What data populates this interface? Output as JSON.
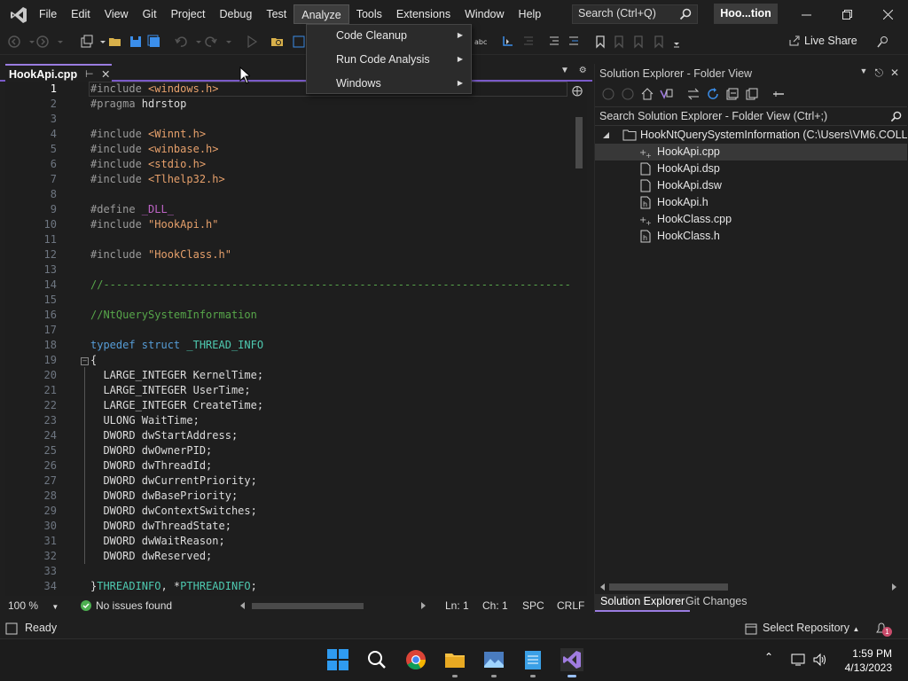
{
  "menubar": {
    "items": [
      "File",
      "Edit",
      "View",
      "Git",
      "Project",
      "Debug",
      "Test",
      "Analyze",
      "Tools",
      "Extensions",
      "Window",
      "Help"
    ],
    "active": "Analyze"
  },
  "search": {
    "placeholder": "Search (Ctrl+Q)"
  },
  "solution_name": "Hoo...tion",
  "toolbar": {
    "live_share_label": "Live Share"
  },
  "analyze_menu": {
    "items": [
      "Code Cleanup",
      "Run Code Analysis",
      "Windows"
    ]
  },
  "editor": {
    "tab_label": "HookApi.cpp",
    "current_line": 1,
    "line_numbers": [
      "1",
      "2",
      "3",
      "4",
      "5",
      "6",
      "7",
      "8",
      "9",
      "10",
      "11",
      "12",
      "13",
      "14",
      "15",
      "16",
      "17",
      "18",
      "19",
      "20",
      "21",
      "22",
      "23",
      "24",
      "25",
      "26",
      "27",
      "28",
      "29",
      "30",
      "31",
      "32",
      "33",
      "34"
    ],
    "lines": [
      {
        "t": [
          [
            "pp",
            "#include "
          ],
          [
            "inc",
            "<windows.h>"
          ]
        ]
      },
      {
        "t": [
          [
            "pp",
            "#pragma "
          ],
          [
            "txt",
            "hdrstop"
          ]
        ]
      },
      {
        "t": []
      },
      {
        "t": [
          [
            "pp",
            "#include "
          ],
          [
            "inc",
            "<Winnt.h>"
          ]
        ]
      },
      {
        "t": [
          [
            "pp",
            "#include "
          ],
          [
            "inc",
            "<winbase.h>"
          ]
        ]
      },
      {
        "t": [
          [
            "pp",
            "#include "
          ],
          [
            "inc",
            "<stdio.h>"
          ]
        ]
      },
      {
        "t": [
          [
            "pp",
            "#include "
          ],
          [
            "inc",
            "<Tlhelp32.h>"
          ]
        ]
      },
      {
        "t": []
      },
      {
        "t": [
          [
            "pp",
            "#define "
          ],
          [
            "macro",
            "_DLL_"
          ]
        ]
      },
      {
        "t": [
          [
            "pp",
            "#include "
          ],
          [
            "str",
            "\"HookApi.h\""
          ]
        ]
      },
      {
        "t": []
      },
      {
        "t": [
          [
            "pp",
            "#include "
          ],
          [
            "str",
            "\"HookClass.h\""
          ]
        ]
      },
      {
        "t": []
      },
      {
        "t": [
          [
            "cmt",
            "//-------------------------------------------------------------------------------------"
          ]
        ]
      },
      {
        "t": []
      },
      {
        "t": [
          [
            "cmt",
            "//NtQuerySystemInformation"
          ]
        ]
      },
      {
        "t": []
      },
      {
        "t": [
          [
            "type",
            "typedef "
          ],
          [
            "type",
            "struct "
          ],
          [
            "cls",
            "_THREAD_INFO"
          ]
        ]
      },
      {
        "t": [
          [
            "txt",
            "{"
          ]
        ]
      },
      {
        "t": [
          [
            "txt",
            "  LARGE_INTEGER KernelTime;"
          ]
        ]
      },
      {
        "t": [
          [
            "txt",
            "  LARGE_INTEGER UserTime;"
          ]
        ]
      },
      {
        "t": [
          [
            "txt",
            "  LARGE_INTEGER CreateTime;"
          ]
        ]
      },
      {
        "t": [
          [
            "txt",
            "  ULONG WaitTime;"
          ]
        ]
      },
      {
        "t": [
          [
            "txt",
            "  DWORD dwStartAddress;"
          ]
        ]
      },
      {
        "t": [
          [
            "txt",
            "  DWORD dwOwnerPID;"
          ]
        ]
      },
      {
        "t": [
          [
            "txt",
            "  DWORD dwThreadId;"
          ]
        ]
      },
      {
        "t": [
          [
            "txt",
            "  DWORD dwCurrentPriority;"
          ]
        ]
      },
      {
        "t": [
          [
            "txt",
            "  DWORD dwBasePriority;"
          ]
        ]
      },
      {
        "t": [
          [
            "txt",
            "  DWORD dwContextSwitches;"
          ]
        ]
      },
      {
        "t": [
          [
            "txt",
            "  DWORD dwThreadState;"
          ]
        ]
      },
      {
        "t": [
          [
            "txt",
            "  DWORD dwWaitReason;"
          ]
        ]
      },
      {
        "t": [
          [
            "txt",
            "  DWORD dwReserved;"
          ]
        ]
      },
      {
        "t": []
      },
      {
        "t": [
          [
            "txt",
            "}"
          ],
          [
            "cls",
            "THREADINFO"
          ],
          [
            "txt",
            ", *"
          ],
          [
            "cls",
            "PTHREADINFO"
          ],
          [
            "txt",
            ";"
          ]
        ]
      }
    ]
  },
  "editor_status": {
    "zoom": "100 %",
    "issues": "No issues found",
    "line": "Ln: 1",
    "char": "Ch: 1",
    "spacing": "SPC",
    "line_ending": "CRLF"
  },
  "solution_explorer": {
    "title": "Solution Explorer - Folder View",
    "search_placeholder": "Search Solution Explorer - Folder View (Ctrl+;)",
    "root": "HookNtQuerySystemInformation (C:\\Users\\VM6.COLLA",
    "files": [
      {
        "name": "HookApi.cpp",
        "icon": "cpp-file-icon",
        "selected": true
      },
      {
        "name": "HookApi.dsp",
        "icon": "file-icon",
        "selected": false
      },
      {
        "name": "HookApi.dsw",
        "icon": "file-icon",
        "selected": false
      },
      {
        "name": "HookApi.h",
        "icon": "header-file-icon",
        "selected": false
      },
      {
        "name": "HookClass.cpp",
        "icon": "cpp-file-icon",
        "selected": false
      },
      {
        "name": "HookClass.h",
        "icon": "header-file-icon",
        "selected": false
      }
    ],
    "tabs": [
      "Solution Explorer",
      "Git Changes"
    ]
  },
  "statusbar": {
    "ready": "Ready",
    "select_repository": "Select Repository",
    "notification_count": "1"
  },
  "clock": {
    "time": "1:59 PM",
    "date": "4/13/2023"
  },
  "colors": {
    "accent": "#9a7ce0",
    "background": "#1f1f1f",
    "editor_bg": "#1e1e1e"
  }
}
